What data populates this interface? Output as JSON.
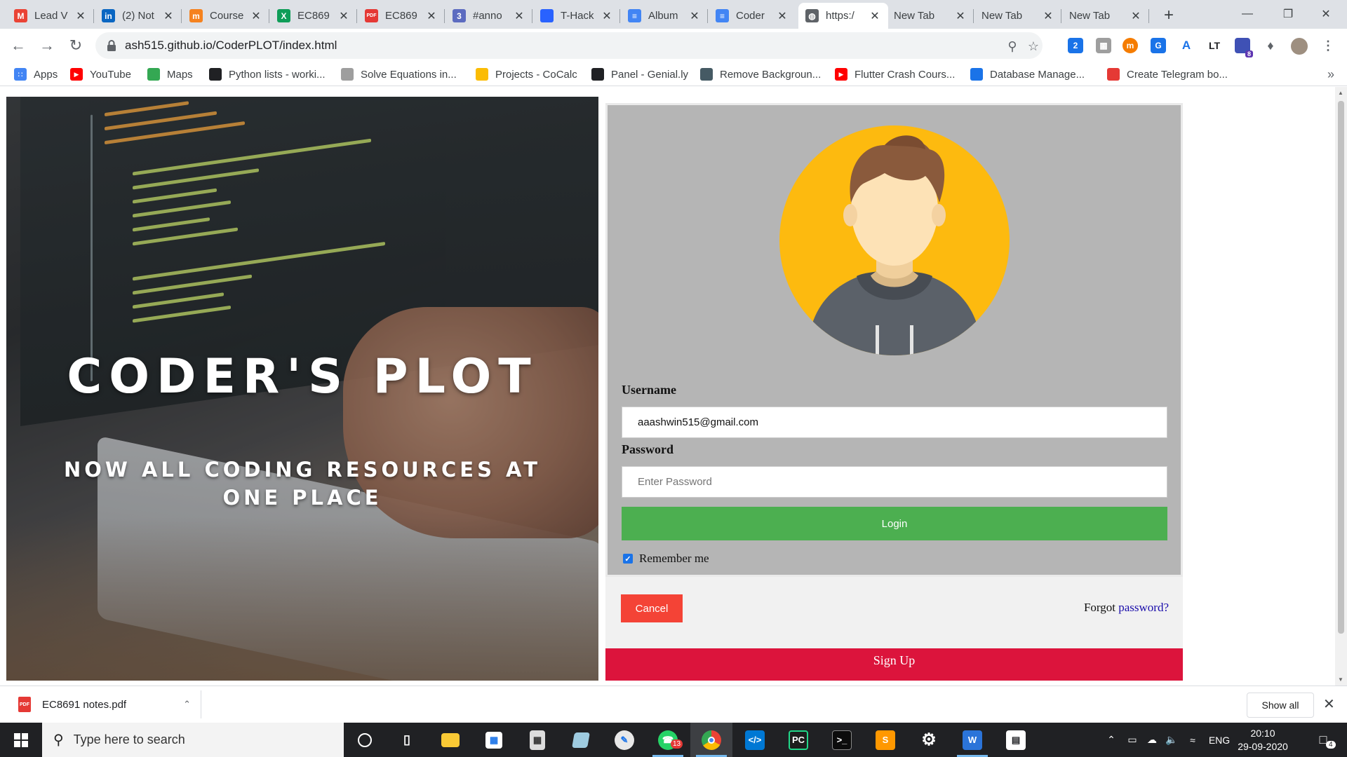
{
  "browser": {
    "tabs": [
      {
        "label": "Lead V",
        "icon": "gmail-icon",
        "color": "#ea4335",
        "glyph": "M"
      },
      {
        "label": "(2) Not",
        "icon": "linkedin-icon",
        "color": "#0a66c2",
        "glyph": "in"
      },
      {
        "label": "Course",
        "icon": "coursera-icon",
        "color": "#f5821f",
        "glyph": "m"
      },
      {
        "label": "EC869",
        "icon": "sheets-icon",
        "color": "#0f9d58",
        "glyph": "X"
      },
      {
        "label": "EC869",
        "icon": "pdf-icon",
        "color": "#e53935",
        "glyph": "PDF"
      },
      {
        "label": "#anno",
        "icon": "github-discussion-icon",
        "color": "#5c6bc0",
        "glyph": "3"
      },
      {
        "label": "T-Hack",
        "icon": "doc-blue-icon",
        "color": "#2962ff",
        "glyph": ""
      },
      {
        "label": "Album",
        "icon": "docs-icon",
        "color": "#4285f4",
        "glyph": "≡"
      },
      {
        "label": "Coder",
        "icon": "docs-icon",
        "color": "#4285f4",
        "glyph": "≡"
      },
      {
        "label": "https:/",
        "icon": "globe-icon",
        "color": "#5f6368",
        "glyph": "◍"
      },
      {
        "label": "New Tab",
        "icon": "",
        "color": "",
        "glyph": ""
      },
      {
        "label": "New Tab",
        "icon": "",
        "color": "",
        "glyph": ""
      },
      {
        "label": "New Tab",
        "icon": "",
        "color": "",
        "glyph": ""
      }
    ],
    "active_tab_index": 9,
    "url": "ash515.github.io/CoderPLOT/index.html"
  },
  "bookmarks": [
    {
      "label": "Apps",
      "icon": "apps-grid-icon",
      "color": "#4285f4"
    },
    {
      "label": "YouTube",
      "icon": "youtube-icon",
      "color": "#ff0000"
    },
    {
      "label": "Maps",
      "icon": "maps-icon",
      "color": "#34a853"
    },
    {
      "label": "Python lists - worki...",
      "icon": "bookmark-square-icon",
      "color": "#202124"
    },
    {
      "label": "Solve Equations in...",
      "icon": "wolfram-icon",
      "color": "#9e9e9e"
    },
    {
      "label": "Projects - CoCalc",
      "icon": "cocalc-icon",
      "color": "#fbbc04"
    },
    {
      "label": "Panel - Genial.ly",
      "icon": "genially-icon",
      "color": "#202124"
    },
    {
      "label": "Remove Backgroun...",
      "icon": "removebg-icon",
      "color": "#455a64"
    },
    {
      "label": "Flutter Crash Cours...",
      "icon": "youtube-icon",
      "color": "#ff0000"
    },
    {
      "label": "Database Manage...",
      "icon": "infinity-icon",
      "color": "#1a73e8"
    },
    {
      "label": "Create Telegram bo...",
      "icon": "telegram-bot-icon",
      "color": "#e53935"
    }
  ],
  "page": {
    "hero_title": "CODER'S PLOT",
    "hero_tagline": "NOW ALL CODING RESOURCES AT ONE PLACE",
    "username_label": "Username",
    "username_value": "aaashwin515@gmail.com",
    "password_label": "Password",
    "password_placeholder": "Enter Password",
    "login_label": "Login",
    "remember_label": "Remember me",
    "remember_checked": true,
    "cancel_label": "Cancel",
    "forgot_prefix": "Forgot",
    "forgot_link": "password?",
    "signup_label": "Sign Up",
    "colors": {
      "avatar_bg": "#fdba0f",
      "login": "#4caf50",
      "cancel": "#f44336",
      "signup": "#dc143c",
      "form_bg": "#b5b5b5"
    }
  },
  "downloads": {
    "file": "EC8691 notes.pdf",
    "show_all": "Show all"
  },
  "taskbar": {
    "search_placeholder": "Type here to search",
    "language": "ENG",
    "time": "20:10",
    "date": "29-09-2020",
    "whatsapp_badge": "13",
    "notification_count": "4",
    "extension_badge": "8"
  }
}
